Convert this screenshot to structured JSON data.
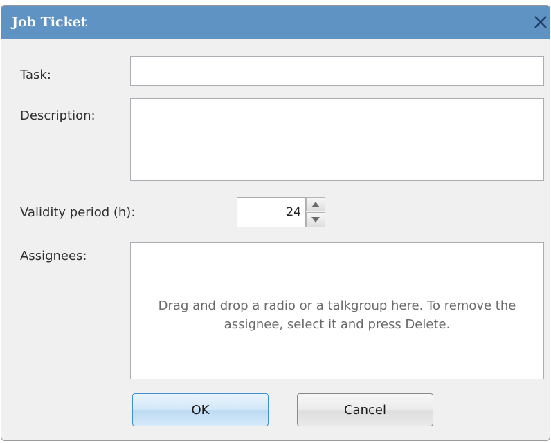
{
  "dialog": {
    "title": "Job Ticket",
    "close_icon": "close-x-icon",
    "titlebar_color": "#5f93c4"
  },
  "form": {
    "task_label": "Task:",
    "task_value": "",
    "description_label": "Description:",
    "description_value": "",
    "validity_label": "Validity period (h):",
    "validity_value": "24",
    "spin_up_icon": "triangle-up-icon",
    "spin_down_icon": "triangle-down-icon",
    "assignees_label": "Assignees:",
    "assignees_hint": "Drag and drop a radio or a talkgroup here. To remove the assignee, select it and press Delete."
  },
  "buttons": {
    "ok": "OK",
    "cancel": "Cancel"
  }
}
